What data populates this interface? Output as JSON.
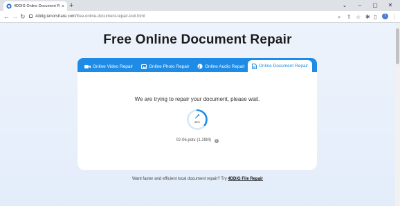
{
  "browser": {
    "tab_title": "4DDIG Online Document Repa",
    "tab_close": "×",
    "new_tab": "+",
    "url_domain": "4ddig.tenorshare.com",
    "url_path": "/free-online-document-repair-tool.html",
    "profile_initial": "T",
    "window_controls": [
      "⌄",
      "–",
      "▢",
      "✕"
    ]
  },
  "page": {
    "headline": "Free Online Document Repair",
    "tools": [
      {
        "label": "Online Video Repair",
        "icon": "video-icon"
      },
      {
        "label": "Online Photo Repair",
        "icon": "photo-icon"
      },
      {
        "label": "Online Audio Repair",
        "icon": "audio-icon"
      },
      {
        "label": "Online Document Repair",
        "icon": "document-icon"
      }
    ],
    "active_tool": "Online Document Repair",
    "status_message": "We are trying to repair your document, please wait.",
    "progress": {
      "percent": 35,
      "label": "35%"
    },
    "file_name": "02-06.potx",
    "file_size": "(1.29M)",
    "footer_text": "Want faster and efficient local document repair? Try",
    "footer_link": "4DDiG File Repair"
  },
  "colors": {
    "accent": "#1e8be6",
    "progress_track": "#d5e7f8"
  }
}
